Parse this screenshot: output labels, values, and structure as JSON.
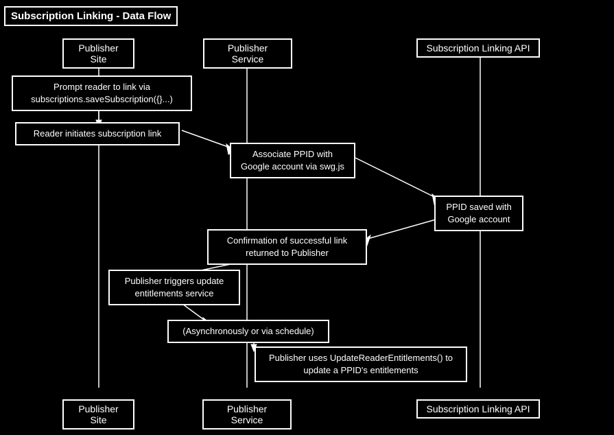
{
  "title": "Subscription Linking - Data Flow",
  "lanes": {
    "top": [
      {
        "id": "pub-site-top",
        "label": "Publisher Site"
      },
      {
        "id": "pub-service-top",
        "label": "Publisher Service"
      },
      {
        "id": "sub-api-top",
        "label": "Subscription Linking API"
      }
    ],
    "bottom": [
      {
        "id": "pub-site-bot",
        "label": "Publisher Site"
      },
      {
        "id": "pub-service-bot",
        "label": "Publisher Service"
      },
      {
        "id": "sub-api-bot",
        "label": "Subscription Linking API"
      }
    ]
  },
  "boxes": {
    "prompt": "Prompt reader to link via\nsubscriptions.saveSubscription({}...)",
    "reader_initiates": "Reader initiates subscription link",
    "associate_ppid": "Associate PPID with\nGoogle account via swg.js",
    "ppid_saved": "PPID saved with\nGoogle account",
    "confirmation": "Confirmation of successful link\nreturned to Publisher",
    "pub_triggers": "Publisher triggers\nupdate entitlements service",
    "async": "(Asynchronously or via schedule)",
    "update_ppid": "Publisher uses UpdateReaderEntitlements()\nto update a PPID's entitlements"
  }
}
